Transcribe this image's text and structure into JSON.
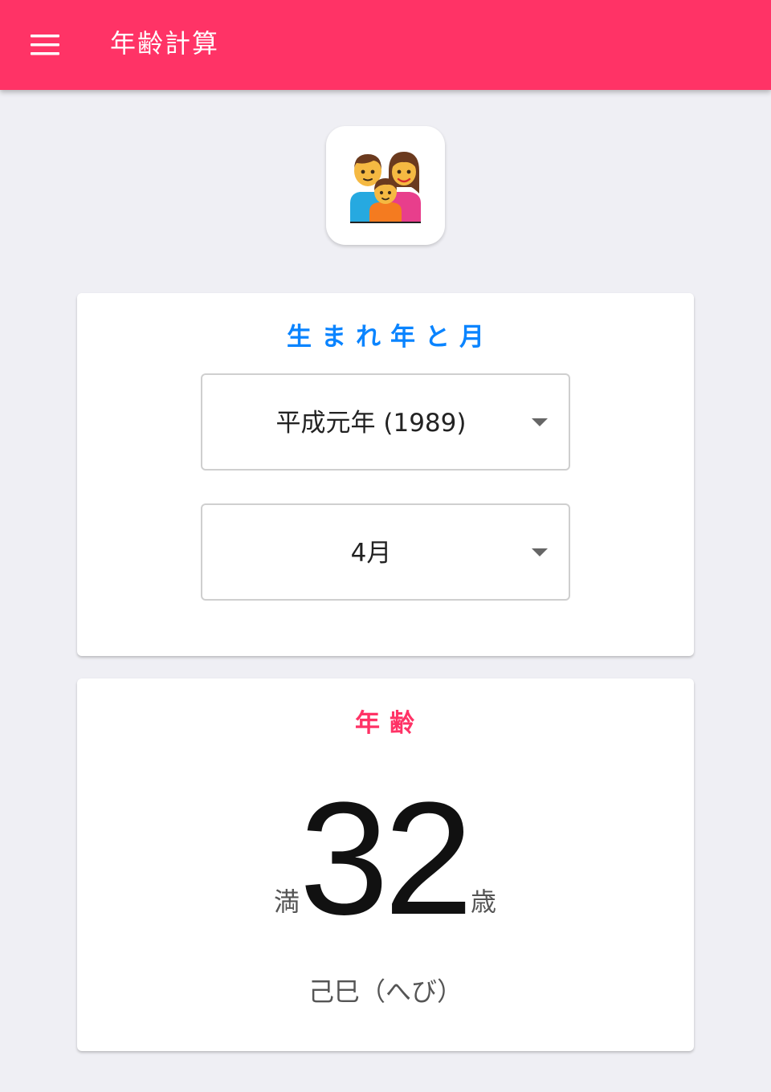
{
  "theme": {
    "primary": "#ff3366",
    "accent_blue": "#0a84ff"
  },
  "appbar": {
    "title": "年齢計算",
    "menu_icon": "hamburger-menu-icon"
  },
  "logo": {
    "icon": "family-icon"
  },
  "birth": {
    "heading": "生まれ年と月",
    "year_select": {
      "value": "平成元年 (1989)"
    },
    "month_select": {
      "value": "4月"
    }
  },
  "age": {
    "heading": "年齢",
    "prefix": "満",
    "value": "32",
    "suffix": "歳",
    "zodiac": "己巳（へび）"
  }
}
